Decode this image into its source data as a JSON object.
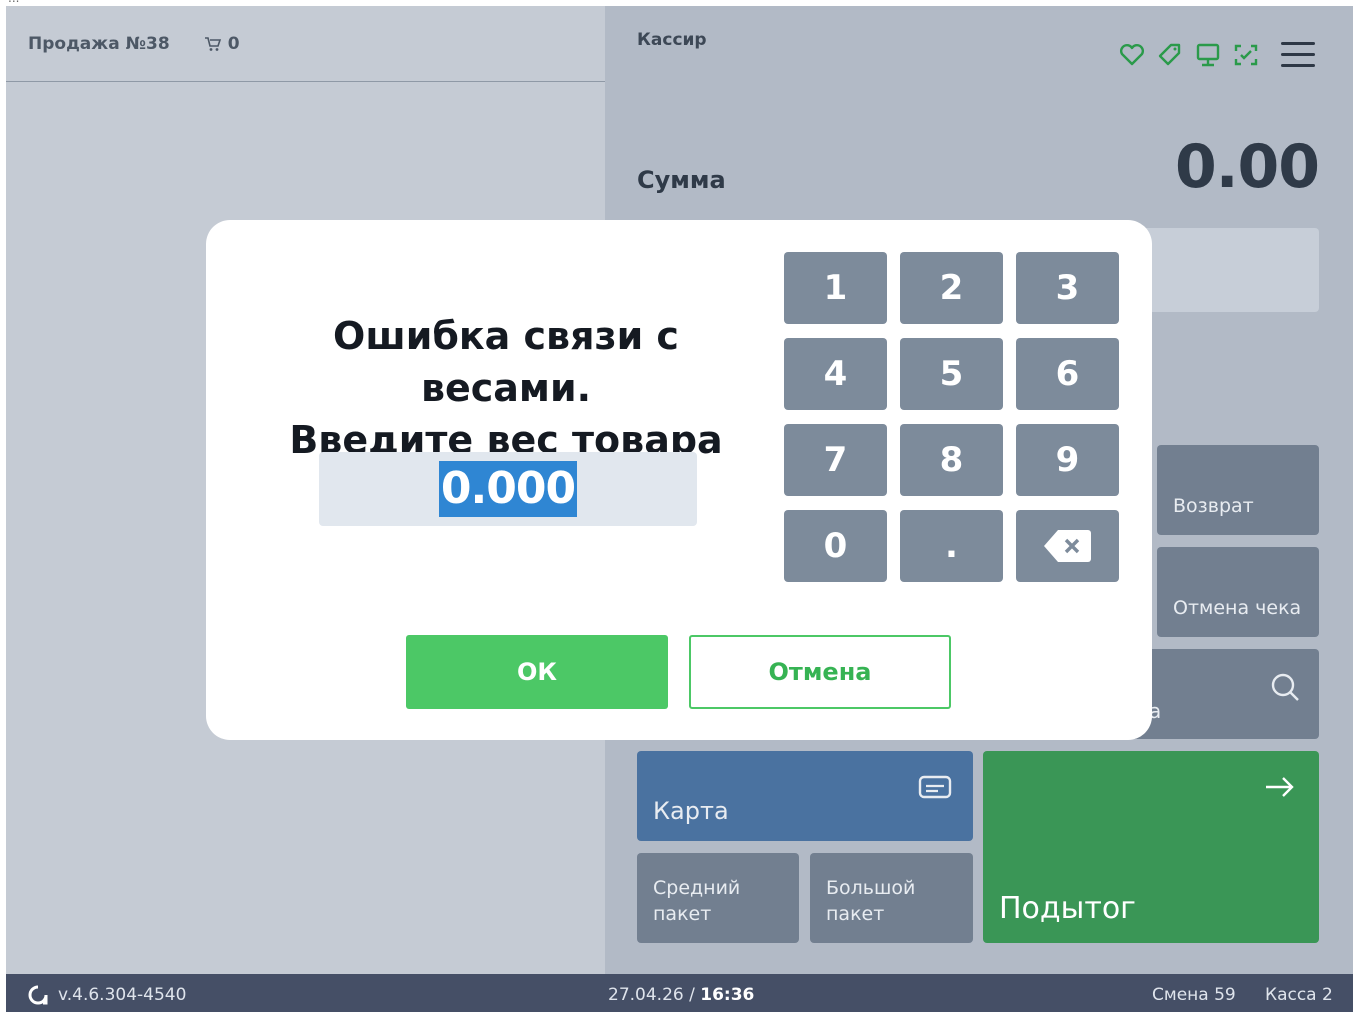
{
  "top_strip_text": "...",
  "header": {
    "sale_title": "Продажа №38",
    "cart_count": "0",
    "cashier": "Кассир",
    "status_icons": [
      "heart-icon",
      "tag-icon",
      "monitor-icon",
      "scan-icon"
    ],
    "status_color": "#2a9a4a"
  },
  "summary": {
    "sum_label": "Сумма",
    "sum_value": "0.00"
  },
  "tiles": {
    "return_label": "Возврат",
    "cancel_receipt_label": "Отмена чека",
    "search_partial": "а",
    "card_label": "Карта",
    "medium_bag_label": "Средний пакет",
    "big_bag_label": "Большой пакет",
    "subtotal_label": "Подытог",
    "card_color": "#4a72a0",
    "subtotal_color": "#3a9656"
  },
  "dialog": {
    "title_line1": "Ошибка связи с весами.",
    "title_line2": "Введите вес товара",
    "weight_value": "0.000",
    "keys": [
      "1",
      "2",
      "3",
      "4",
      "5",
      "6",
      "7",
      "8",
      "9",
      "0",
      "."
    ],
    "ok_label": "ОК",
    "cancel_label": "Отмена",
    "accent_color": "#4cc866"
  },
  "footer": {
    "version": "v.4.6.304-4540",
    "date": "27.04.26",
    "separator": "/",
    "time": "16:36",
    "shift": "Смена 59",
    "till": "Касса 2"
  }
}
